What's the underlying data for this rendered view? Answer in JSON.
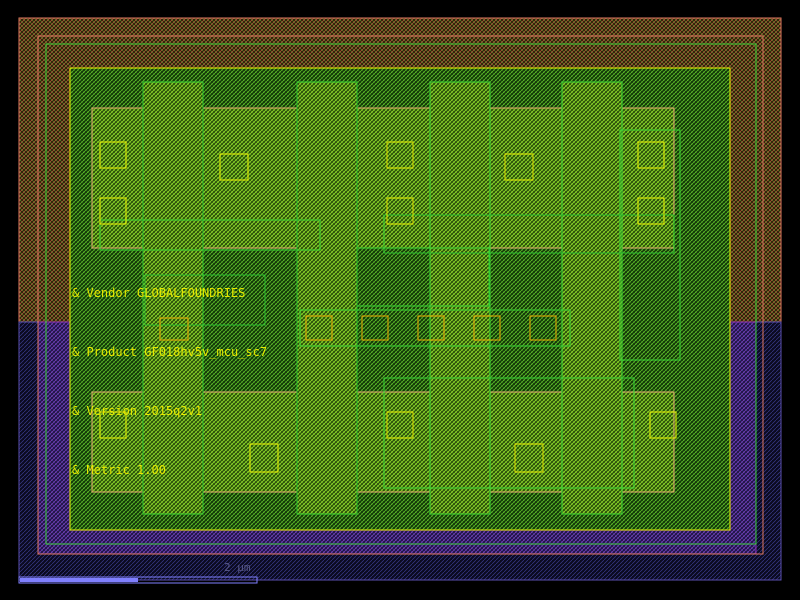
{
  "colors": {
    "background": "#000000",
    "nwell": "#e07860",
    "pwell": "#5a4fb0",
    "pwell_fill": "#8a2fb0",
    "comp": "#33cc33",
    "poly": "#cc3030",
    "metal1": "#2d6cd0",
    "text": "#e8e800",
    "boundary": "#e8e800",
    "scale": "#8080ff"
  },
  "annotations": [
    {
      "text": "& Vendor GLOBALFOUNDRIES"
    },
    {
      "text": "& Product GF018hv5v_mcu_sc7"
    },
    {
      "text": "& Version 2015q2v1"
    },
    {
      "text": "& Metric 1.00"
    }
  ],
  "scale_bar": {
    "label": "2 µm"
  }
}
